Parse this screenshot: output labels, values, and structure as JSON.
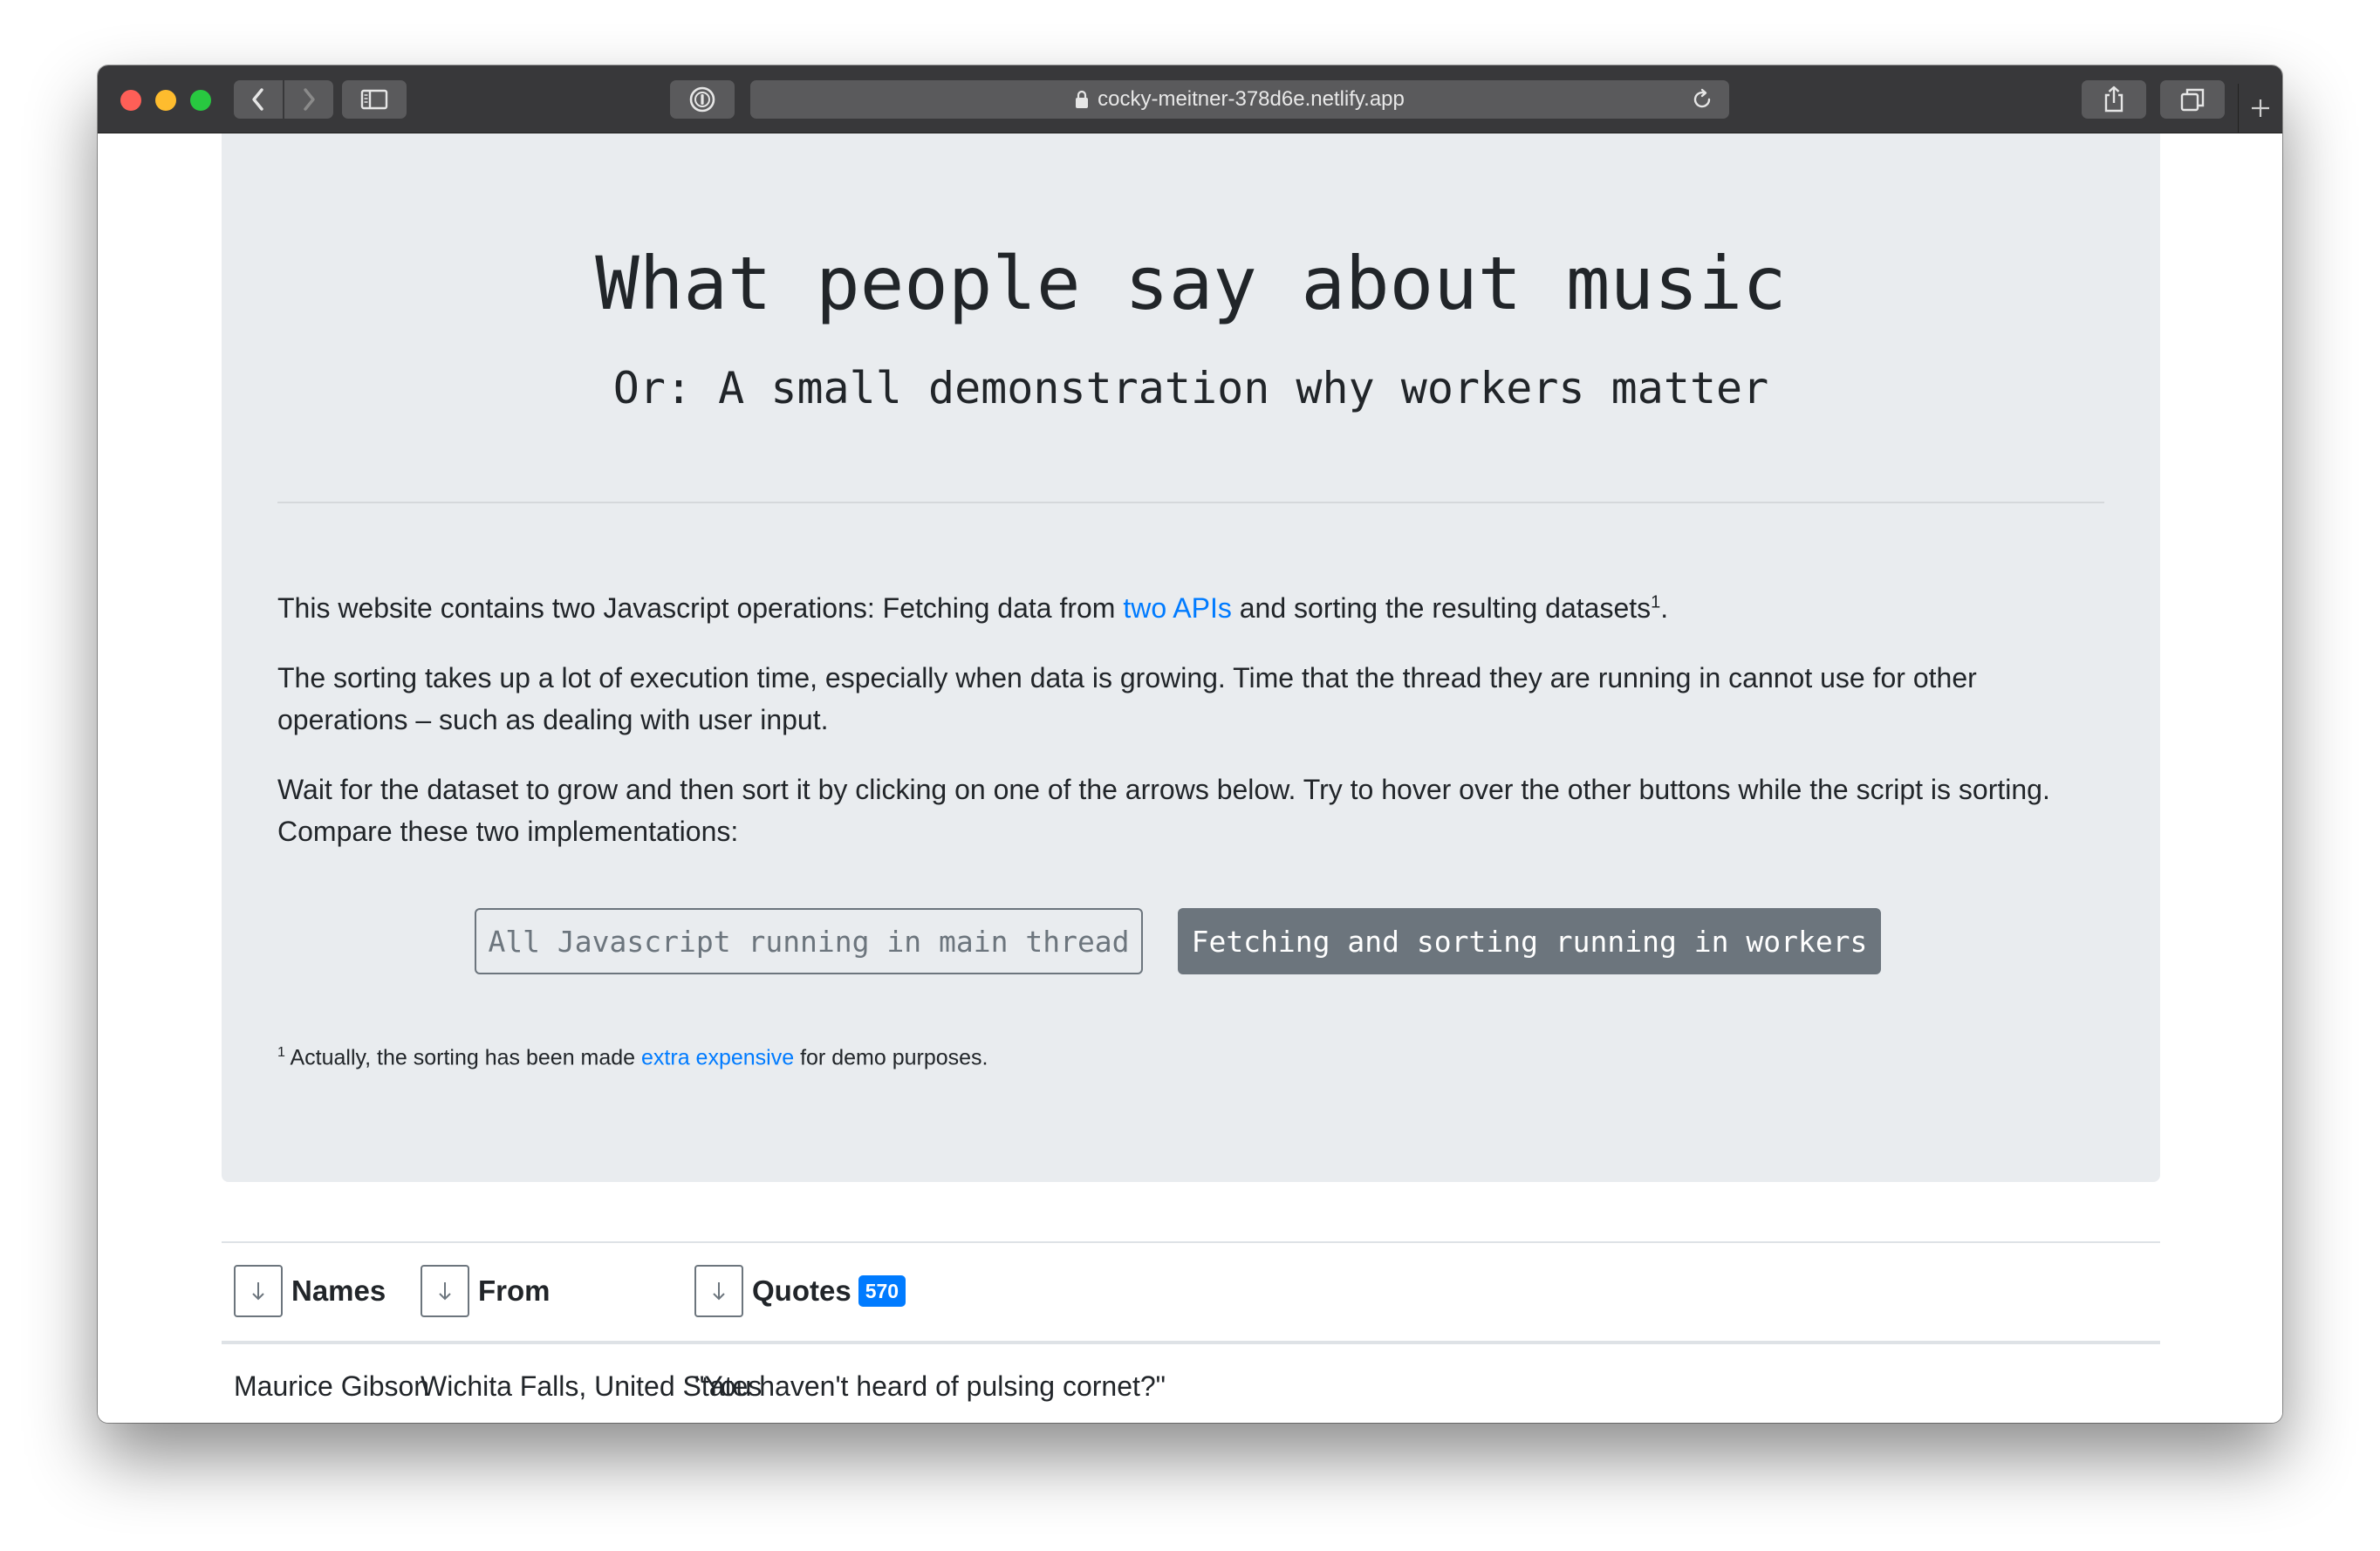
{
  "browser": {
    "url": "cocky-meitner-378d6e.netlify.app",
    "colors": {
      "toolbar": "#38383a",
      "close": "#fe5f57",
      "minimize": "#febc2e",
      "zoom": "#28c840"
    }
  },
  "hero": {
    "title": "What people say about music",
    "subtitle": "Or: A small demonstration why workers matter",
    "intro_before": "This website contains two Javascript operations: Fetching data from ",
    "intro_link": "two APIs",
    "intro_after": " and sorting the resulting datasets",
    "intro_sup": "1",
    "intro_end": ".",
    "paragraph2": "The sorting takes up a lot of execution time, especially when data is growing. Time that the thread they are running in cannot use for other operations – such as dealing with user input.",
    "paragraph3": "Wait for the dataset to grow and then sort it by clicking on one of the arrows below. Try to hover over the other buttons while the script is sorting. Compare these two implementations:",
    "button_main_thread": "All Javascript running in main thread",
    "button_workers": "Fetching and sorting running in workers",
    "footnote_sup": "1",
    "footnote_before": " Actually, the sorting has been made ",
    "footnote_link": "extra expensive",
    "footnote_after": " for demo purposes."
  },
  "table": {
    "columns": [
      {
        "label": "Names"
      },
      {
        "label": "From"
      },
      {
        "label": "Quotes",
        "badge": "570"
      }
    ],
    "rows": [
      {
        "name": "Maurice Gibson",
        "from": "Wichita Falls, United States",
        "quote": "\"You haven't heard of pulsing cornet?\""
      }
    ]
  },
  "colors": {
    "accent": "#007bff",
    "secondary": "#6c757d",
    "jumbotron": "#e9ecef"
  }
}
